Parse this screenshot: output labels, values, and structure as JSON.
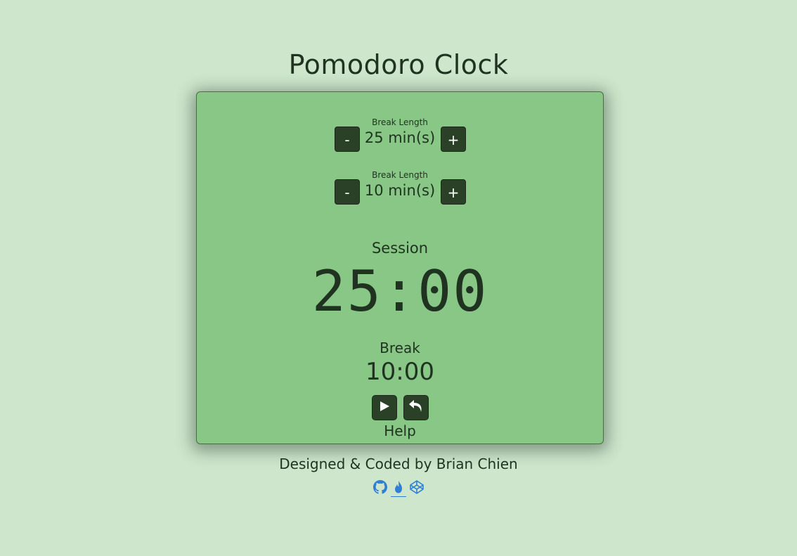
{
  "page": {
    "title": "Pomodoro Clock"
  },
  "settings": {
    "session_length": {
      "label": "Break Length",
      "value": "25 min(s)",
      "decrement_label": "-",
      "increment_label": "+"
    },
    "break_length": {
      "label": "Break Length",
      "value": "10 min(s)",
      "decrement_label": "-",
      "increment_label": "+"
    }
  },
  "timer": {
    "session_label": "Session",
    "session_time": "25:00",
    "break_label": "Break",
    "break_time": "10:00"
  },
  "controls": {
    "play_icon": "play-icon",
    "reset_icon": "undo-icon",
    "help_label": "Help"
  },
  "footer": {
    "credit": "Designed & Coded by Brian Chien",
    "icons": [
      "github-icon",
      "freecodecamp-icon",
      "codepen-icon"
    ],
    "icon_color": "#2f7fd6"
  },
  "colors": {
    "background": "#cde6cc",
    "card": "#88c786",
    "button": "#2a4127",
    "text": "#1f3320"
  }
}
